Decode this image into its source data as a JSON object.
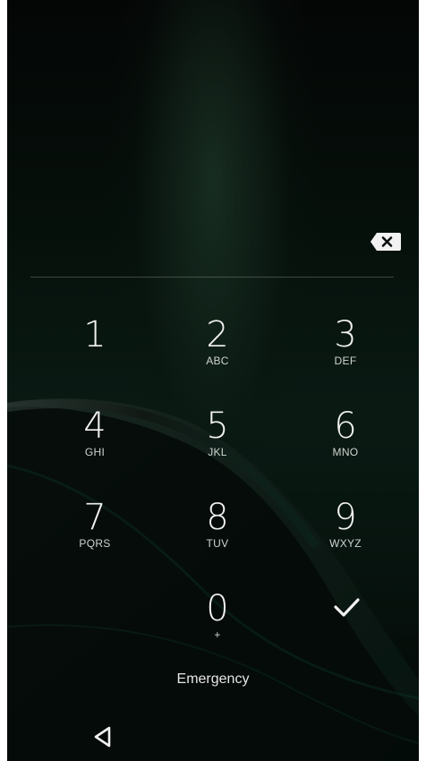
{
  "keypad": {
    "keys": [
      {
        "digit": "1",
        "letters": ""
      },
      {
        "digit": "2",
        "letters": "ABC"
      },
      {
        "digit": "3",
        "letters": "DEF"
      },
      {
        "digit": "4",
        "letters": "GHI"
      },
      {
        "digit": "5",
        "letters": "JKL"
      },
      {
        "digit": "6",
        "letters": "MNO"
      },
      {
        "digit": "7",
        "letters": "PQRS"
      },
      {
        "digit": "8",
        "letters": "TUV"
      },
      {
        "digit": "9",
        "letters": "WXYZ"
      },
      {
        "digit": "0",
        "letters": "+"
      }
    ],
    "backspace_icon": "backspace-icon",
    "enter_icon": "checkmark-icon"
  },
  "emergency_label": "Emergency",
  "navigation": {
    "back_icon": "back-triangle-icon"
  },
  "colors": {
    "background_dark": "#040605",
    "background_green": "#0a1a13",
    "text": "#f2f2f2"
  }
}
